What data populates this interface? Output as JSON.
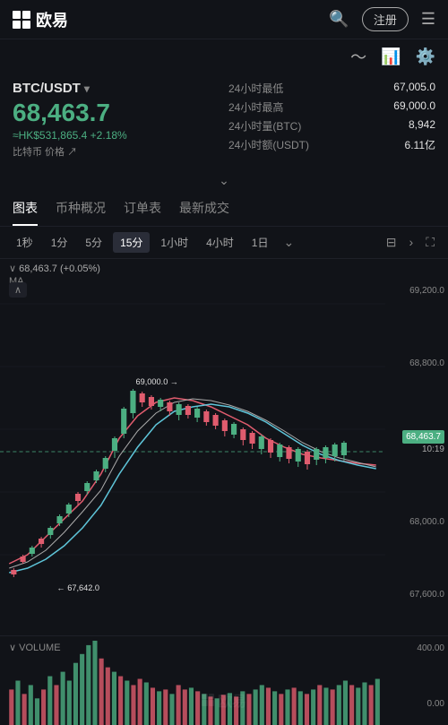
{
  "header": {
    "logo_text": "欧易",
    "register_label": "注册",
    "search_icon": "🔍"
  },
  "price_info": {
    "pair": "BTC/USDT",
    "main_price": "68,463.7",
    "hk_price": "≈HK$531,865.4",
    "change_pct": "+2.18%",
    "low_24h_label": "24小时最低",
    "low_24h_value": "67,005.0",
    "high_24h_label": "24小时最高",
    "high_24h_value": "69,000.0",
    "vol_btc_label": "24小时量(BTC)",
    "vol_btc_value": "8,942",
    "vol_usdt_label": "24小时额(USDT)",
    "vol_usdt_value": "6.11亿",
    "btc_label": "比特币 价格"
  },
  "tabs": [
    {
      "label": "图表",
      "active": true
    },
    {
      "label": "币种概况",
      "active": false
    },
    {
      "label": "订单表",
      "active": false
    },
    {
      "label": "最新成交",
      "active": false
    }
  ],
  "intervals": [
    {
      "label": "1秒",
      "active": false
    },
    {
      "label": "1分",
      "active": false
    },
    {
      "label": "5分",
      "active": false
    },
    {
      "label": "15分",
      "active": true
    },
    {
      "label": "1小时",
      "active": false
    },
    {
      "label": "4小时",
      "active": false
    },
    {
      "label": "1日",
      "active": false
    }
  ],
  "chart": {
    "current_price_tag": "68,463.7",
    "current_time_tag": "10:19",
    "price_levels": [
      "69,200.0",
      "68,800.0",
      "",
      "68,000.0",
      "67,600.0"
    ],
    "annotation_high": "69,000.0 →",
    "annotation_low": "← 67,642.0",
    "overlay_price": "68,463.7 (+0.05%)",
    "ma_label": "MA"
  },
  "volume": {
    "section_label": "∨ VOLUME",
    "axis_top": "400.00",
    "axis_bottom": "0.00"
  },
  "watermark": "✦ 欧易"
}
